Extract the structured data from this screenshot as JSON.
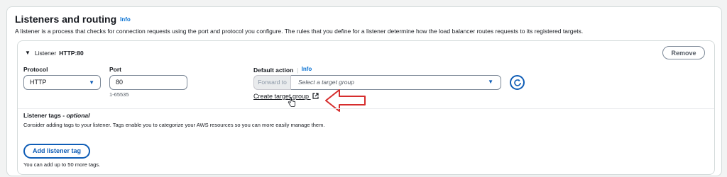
{
  "section": {
    "title": "Listeners and routing",
    "info": "Info",
    "description": "A listener is a process that checks for connection requests using the port and protocol you configure. The rules that you define for a listener determine how the load balancer routes requests to its registered targets."
  },
  "listener": {
    "prefix": "Listener",
    "name": "HTTP:80",
    "remove_label": "Remove",
    "protocol": {
      "label": "Protocol",
      "value": "HTTP"
    },
    "port": {
      "label": "Port",
      "value": "80",
      "hint": "1-65535"
    },
    "default_action": {
      "label": "Default action",
      "info": "Info",
      "forward_label": "Forward to",
      "placeholder": "Select a target group",
      "create_link": "Create target group"
    },
    "tags": {
      "title": "Listener tags - ",
      "optional": "optional",
      "description": "Consider adding tags to your listener. Tags enable you to categorize your AWS resources so you can more easily manage them.",
      "add_label": "Add listener tag",
      "hint": "You can add up to 50 more tags."
    }
  },
  "colors": {
    "accent": "#0f5db6",
    "annotation_arrow": "#d62d2d"
  }
}
